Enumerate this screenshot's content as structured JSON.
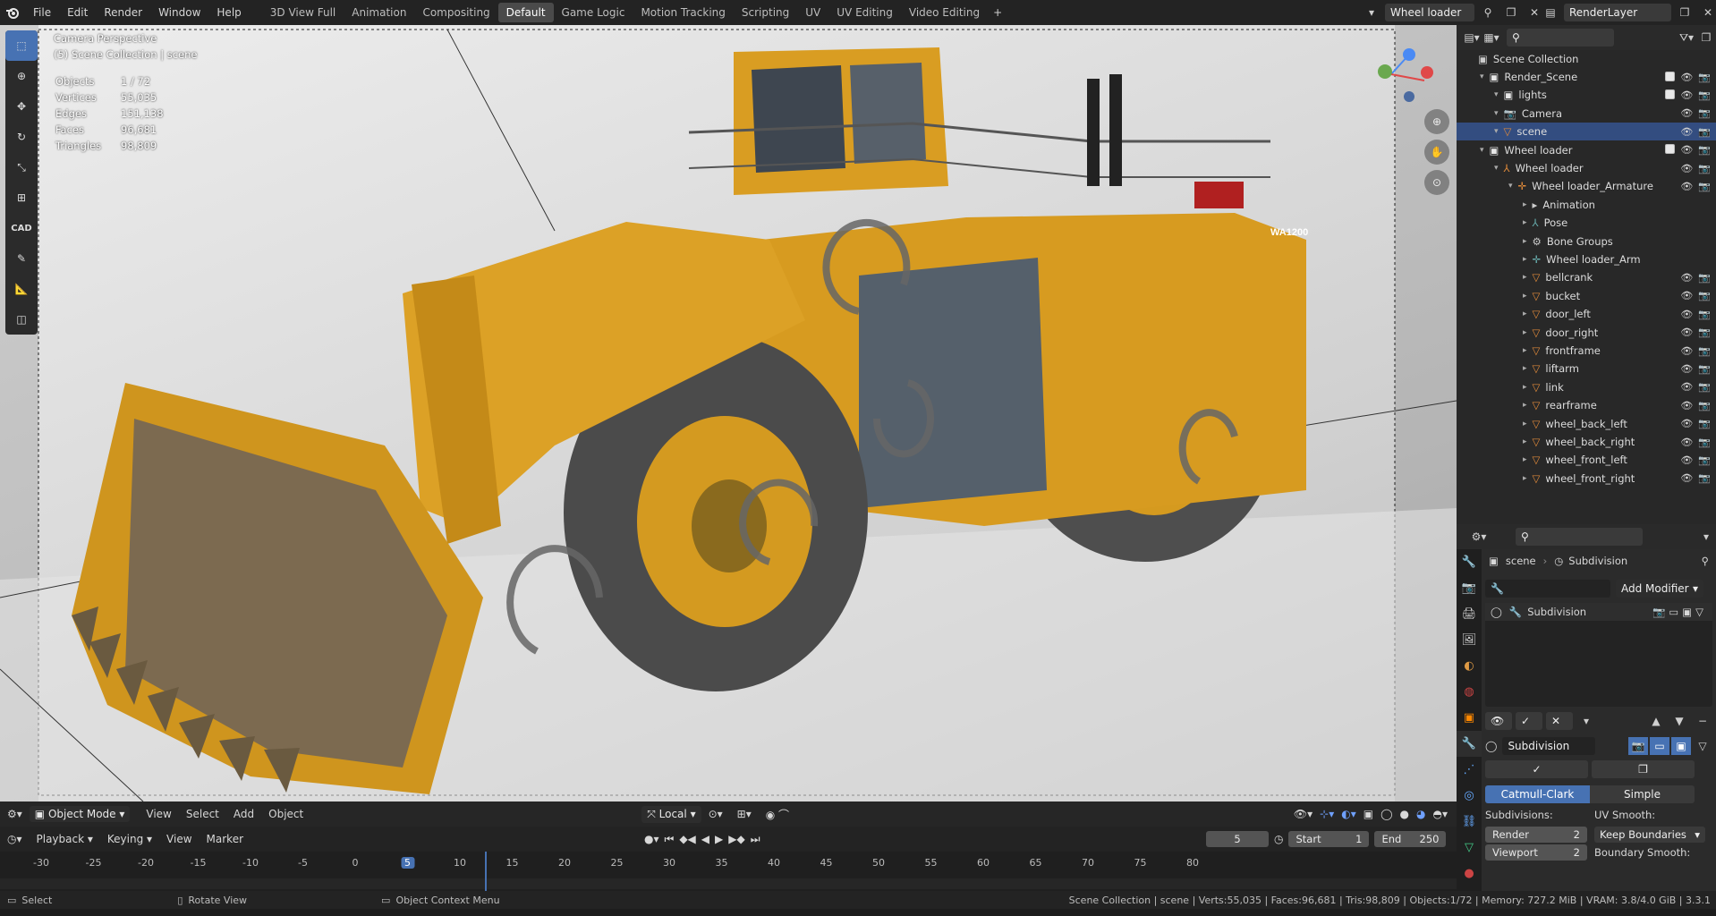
{
  "menu": [
    "File",
    "Edit",
    "Render",
    "Window",
    "Help"
  ],
  "workspaces": [
    "3D View Full",
    "Animation",
    "Compositing",
    "Default",
    "Game Logic",
    "Motion Tracking",
    "Scripting",
    "UV",
    "UV Editing",
    "Video Editing"
  ],
  "active_workspace": "Default",
  "scene_name": "Wheel loader",
  "view_layer": "RenderLayer",
  "viewport": {
    "title": "Camera Perspective",
    "collection": "(5) Scene Collection | scene",
    "stats": [
      {
        "k": "Objects",
        "v": "1 / 72"
      },
      {
        "k": "Vertices",
        "v": "55,035"
      },
      {
        "k": "Edges",
        "v": "151,138"
      },
      {
        "k": "Faces",
        "v": "96,681"
      },
      {
        "k": "Triangles",
        "v": "98,809"
      }
    ],
    "cad_label": "CAD",
    "model_plate": "WA1200"
  },
  "vpheader": {
    "mode": "Object Mode",
    "menus": [
      "View",
      "Select",
      "Add",
      "Object"
    ],
    "orientation": "Local"
  },
  "timeline": {
    "menus": [
      "Playback",
      "Keying",
      "View",
      "Marker"
    ],
    "current_frame": "5",
    "start_label": "Start",
    "start": "1",
    "end_label": "End",
    "end": "250",
    "ticks": [
      "-30",
      "-25",
      "-20",
      "-15",
      "-10",
      "-5",
      "0",
      "5",
      "10",
      "15",
      "20",
      "25",
      "30",
      "35",
      "40",
      "45",
      "50",
      "55",
      "60",
      "65",
      "70",
      "75",
      "80"
    ]
  },
  "status": {
    "select": "Select",
    "rotate": "Rotate View",
    "context": "Object Context Menu",
    "info": "Scene Collection | scene | Verts:55,035 | Faces:96,681 | Tris:98,809 | Objects:1/72 | Memory: 727.2 MiB | VRAM: 3.8/4.0 GiB | 3.3.1"
  },
  "outliner": {
    "root": "Scene Collection",
    "rows": [
      {
        "label": "Render_Scene",
        "indent": 1,
        "kind": "collection"
      },
      {
        "label": "lights",
        "indent": 2,
        "kind": "collection"
      },
      {
        "label": "Camera",
        "indent": 2,
        "kind": "camera"
      },
      {
        "label": "scene",
        "indent": 2,
        "kind": "mesh",
        "selected": true
      },
      {
        "label": "Wheel loader",
        "indent": 1,
        "kind": "collection"
      },
      {
        "label": "Wheel loader",
        "indent": 2,
        "kind": "armature-obj"
      },
      {
        "label": "Wheel loader_Armature",
        "indent": 3,
        "kind": "armature"
      },
      {
        "label": "Animation",
        "indent": 4,
        "kind": "anim"
      },
      {
        "label": "Pose",
        "indent": 4,
        "kind": "pose"
      },
      {
        "label": "Bone Groups",
        "indent": 4,
        "kind": "bones"
      },
      {
        "label": "Wheel loader_Arm",
        "indent": 4,
        "kind": "armdata"
      },
      {
        "label": "bellcrank",
        "indent": 4,
        "kind": "mesh"
      },
      {
        "label": "bucket",
        "indent": 4,
        "kind": "mesh"
      },
      {
        "label": "door_left",
        "indent": 4,
        "kind": "mesh"
      },
      {
        "label": "door_right",
        "indent": 4,
        "kind": "mesh"
      },
      {
        "label": "frontframe",
        "indent": 4,
        "kind": "mesh"
      },
      {
        "label": "liftarm",
        "indent": 4,
        "kind": "mesh"
      },
      {
        "label": "link",
        "indent": 4,
        "kind": "mesh"
      },
      {
        "label": "rearframe",
        "indent": 4,
        "kind": "mesh"
      },
      {
        "label": "wheel_back_left",
        "indent": 4,
        "kind": "mesh"
      },
      {
        "label": "wheel_back_right",
        "indent": 4,
        "kind": "mesh"
      },
      {
        "label": "wheel_front_left",
        "indent": 4,
        "kind": "mesh"
      },
      {
        "label": "wheel_front_right",
        "indent": 4,
        "kind": "mesh"
      }
    ]
  },
  "properties": {
    "breadcrumb_obj": "scene",
    "breadcrumb_mod": "Subdivision",
    "add_modifier": "Add Modifier",
    "modifier_list_item": "Subdivision",
    "modifier_name": "Subdivision",
    "tab_catmull": "Catmull-Clark",
    "tab_simple": "Simple",
    "subdivisions_label": "Subdivisions:",
    "render_label": "Render",
    "render_value": "2",
    "viewport_label": "Viewport",
    "viewport_value": "2",
    "uv_smooth_label": "UV Smooth:",
    "uv_smooth_value": "Keep Boundaries",
    "boundary_smooth_label": "Boundary Smooth:"
  },
  "colors": {
    "accent": "#4772b3",
    "machine_yellow": "#e8a21e",
    "tire": "#4b4b4b"
  }
}
